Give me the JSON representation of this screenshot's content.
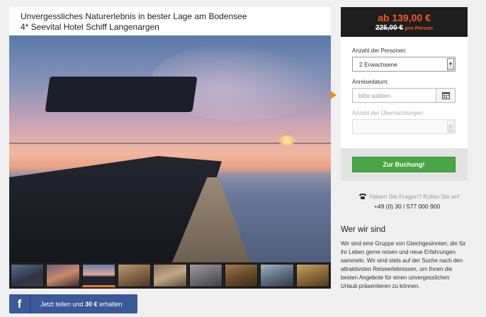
{
  "listing": {
    "title_line1": "Unvergessliches Naturerlebnis in bester Lage am Bodensee",
    "title_line2": "4* Seevital Hotel Schiff Langenargen"
  },
  "gallery": {
    "thumbnail_count": 9,
    "active_index": 2
  },
  "share": {
    "icon": "facebook-icon",
    "label_prefix": "Jetzt teilen und ",
    "label_amount": "30 €",
    "label_suffix": " erhalten",
    "color": "#3b5998"
  },
  "price": {
    "current": "ab 139,00 €",
    "old": "225,00 €",
    "per": "pro Person",
    "accent": "#f15a24"
  },
  "booking_form": {
    "persons_label": "Anzahl der Personen:",
    "persons_value": "2 Erwachsene",
    "date_label": "Anreisedatum:",
    "date_placeholder": "bitte wählen",
    "nights_label": "Anzahl der Übernachtungen:",
    "nights_value": ""
  },
  "book_button": {
    "label": "Zur Buchung!",
    "color": "#4aa547"
  },
  "contact": {
    "icon": "phone-icon",
    "question": "Haben Sie Fragen? Rufen Sie an!",
    "phone": "+49 (0) 30 / 577 000 900"
  },
  "about": {
    "heading": "Wer wir sind",
    "text": "Wir sind eine Gruppe von Gleichgesinnten, die für ihr Leben gerne reisen und neue Erfahrungen sammeln. Wir sind stets auf der Suche nach den attraktivsten Reiseerlebnissen, um Ihnen die besten Angebote für einen unvergesslichen Urlaub präsentieren zu können."
  }
}
